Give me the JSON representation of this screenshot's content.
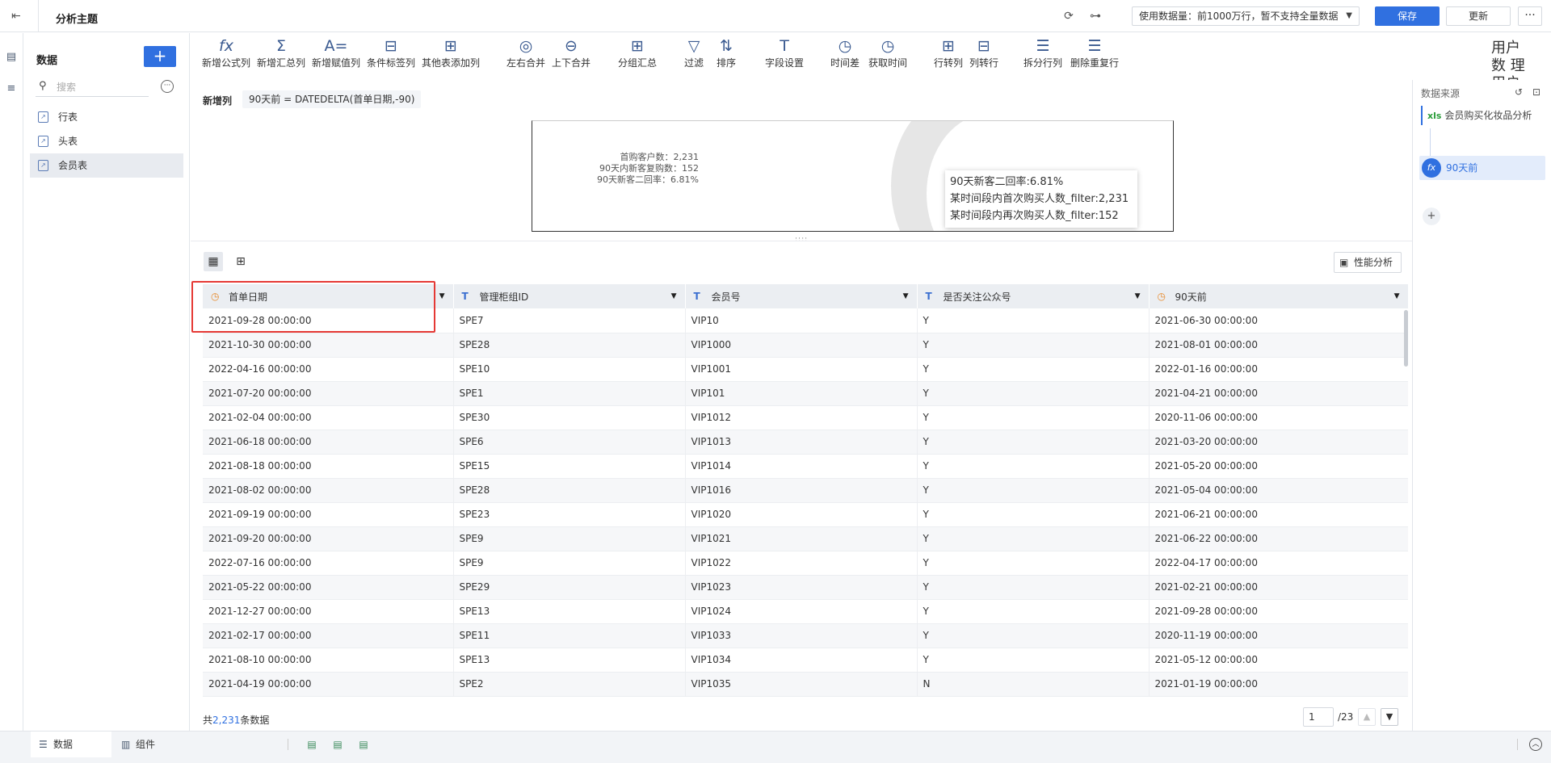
{
  "topbar": {
    "title": "分析主题",
    "data_cap": "使用数据量：前1000万行，暂不支持全量数据",
    "save_label": "保存",
    "update_label": "更新",
    "more_label": "···"
  },
  "data_panel": {
    "title": "数据",
    "add_label": "+",
    "search_placeholder": "搜索",
    "tables": [
      {
        "label": "行表"
      },
      {
        "label": "头表"
      },
      {
        "label": "会员表"
      }
    ]
  },
  "toolbar": {
    "tools": [
      {
        "label": "新增公式列",
        "icon": "fx"
      },
      {
        "label": "新增汇总列",
        "icon": "Σ"
      },
      {
        "label": "新增赋值列",
        "icon": "A="
      },
      {
        "label": "条件标签列",
        "icon": "⊟"
      },
      {
        "label": "其他表添加列",
        "icon": "⊞"
      },
      {
        "label": "左右合并",
        "icon": "◎"
      },
      {
        "label": "上下合并",
        "icon": "⊖"
      },
      {
        "label": "分组汇总",
        "icon": "⊞"
      },
      {
        "label": "过滤",
        "icon": "▽"
      },
      {
        "label": "排序",
        "icon": "⇅"
      },
      {
        "label": "字段设置",
        "icon": "T"
      },
      {
        "label": "时间差",
        "icon": "◷"
      },
      {
        "label": "获取时间",
        "icon": "◷"
      },
      {
        "label": "行转列",
        "icon": "⊞"
      },
      {
        "label": "列转行",
        "icon": "⊟"
      },
      {
        "label": "拆分行列",
        "icon": "☰"
      },
      {
        "label": "删除重复行",
        "icon": "☰"
      }
    ],
    "cut_text": "用户数 理用户"
  },
  "formula": {
    "label": "新增列",
    "value": "90天前 = DATEDELTA(首单日期,-90)"
  },
  "preview": {
    "stats": [
      "首购客户数：2,231",
      "90天内新客复购数：152",
      "90天新客二回率：6.81%"
    ],
    "tooltip": [
      "90天新客二回率:6.81%",
      "某时间段内首次购买人数_filter:2,231",
      "某时间段内再次购买人数_filter:152"
    ]
  },
  "view": {
    "perf_label": "性能分析"
  },
  "table": {
    "columns": [
      {
        "label": "首单日期",
        "type": "date"
      },
      {
        "label": "管理柜组ID",
        "type": "text"
      },
      {
        "label": "会员号",
        "type": "text"
      },
      {
        "label": "是否关注公众号",
        "type": "text"
      },
      {
        "label": "90天前",
        "type": "date"
      }
    ],
    "rows": [
      [
        "2021-09-28 00:00:00",
        "SPE7",
        "VIP10",
        "Y",
        "2021-06-30 00:00:00"
      ],
      [
        "2021-10-30 00:00:00",
        "SPE28",
        "VIP1000",
        "Y",
        "2021-08-01 00:00:00"
      ],
      [
        "2022-04-16 00:00:00",
        "SPE10",
        "VIP1001",
        "Y",
        "2022-01-16 00:00:00"
      ],
      [
        "2021-07-20 00:00:00",
        "SPE1",
        "VIP101",
        "Y",
        "2021-04-21 00:00:00"
      ],
      [
        "2021-02-04 00:00:00",
        "SPE30",
        "VIP1012",
        "Y",
        "2020-11-06 00:00:00"
      ],
      [
        "2021-06-18 00:00:00",
        "SPE6",
        "VIP1013",
        "Y",
        "2021-03-20 00:00:00"
      ],
      [
        "2021-08-18 00:00:00",
        "SPE15",
        "VIP1014",
        "Y",
        "2021-05-20 00:00:00"
      ],
      [
        "2021-08-02 00:00:00",
        "SPE28",
        "VIP1016",
        "Y",
        "2021-05-04 00:00:00"
      ],
      [
        "2021-09-19 00:00:00",
        "SPE23",
        "VIP1020",
        "Y",
        "2021-06-21 00:00:00"
      ],
      [
        "2021-09-20 00:00:00",
        "SPE9",
        "VIP1021",
        "Y",
        "2021-06-22 00:00:00"
      ],
      [
        "2022-07-16 00:00:00",
        "SPE9",
        "VIP1022",
        "Y",
        "2022-04-17 00:00:00"
      ],
      [
        "2021-05-22 00:00:00",
        "SPE29",
        "VIP1023",
        "Y",
        "2021-02-21 00:00:00"
      ],
      [
        "2021-12-27 00:00:00",
        "SPE13",
        "VIP1024",
        "Y",
        "2021-09-28 00:00:00"
      ],
      [
        "2021-02-17 00:00:00",
        "SPE11",
        "VIP1033",
        "Y",
        "2020-11-19 00:00:00"
      ],
      [
        "2021-08-10 00:00:00",
        "SPE13",
        "VIP1034",
        "Y",
        "2021-05-12 00:00:00"
      ],
      [
        "2021-04-19 00:00:00",
        "SPE2",
        "VIP1035",
        "N",
        "2021-01-19 00:00:00"
      ]
    ]
  },
  "footer": {
    "total_prefix": "共",
    "total_count": "2,231",
    "total_suffix": "条数据",
    "page_value": "1",
    "page_total": "/23"
  },
  "lineage": {
    "title": "数据来源",
    "source_tag": "xls",
    "source_label": "会员购买化妆品分析",
    "step_icon": "fx",
    "step_label": "90天前",
    "add_label": "+"
  },
  "bottombar": {
    "tabs": [
      {
        "label": "数据"
      },
      {
        "label": "组件"
      }
    ]
  }
}
